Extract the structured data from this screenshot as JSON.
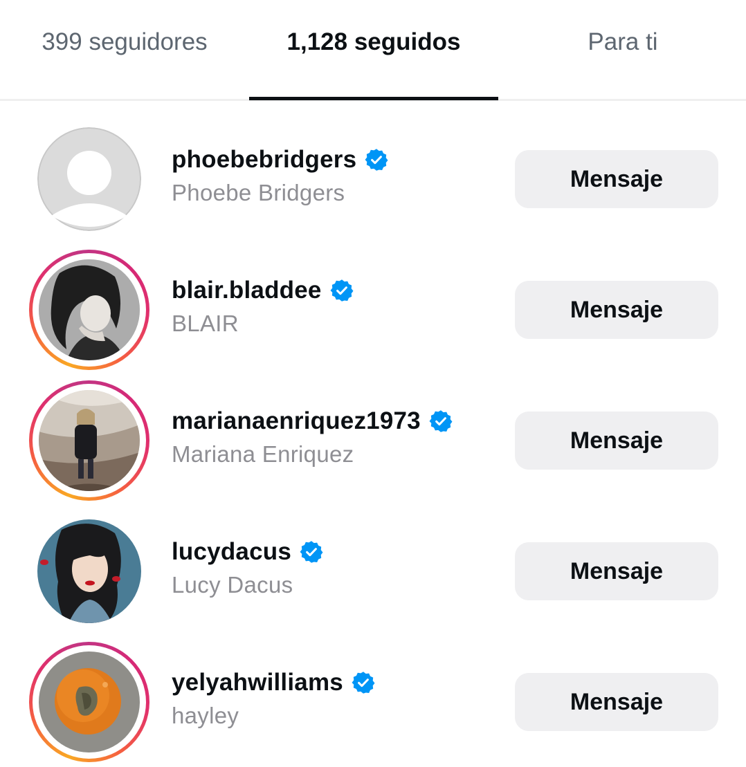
{
  "tabs": {
    "followers": "399 seguidores",
    "following": "1,128 seguidos",
    "for_you": "Para ti"
  },
  "colors": {
    "verified_badge": "#0095f6",
    "active_tab": "#0c1014",
    "button_bg": "#efeff1"
  },
  "icons": {
    "verified": "verified-badge-icon",
    "default_avatar": "default-avatar-icon"
  },
  "accounts": [
    {
      "username": "phoebebridgers",
      "full_name": "Phoebe Bridgers",
      "verified": true,
      "has_story": false,
      "button": "Mensaje"
    },
    {
      "username": "blair.bladdee",
      "full_name": "BLAIR",
      "verified": true,
      "has_story": true,
      "button": "Mensaje"
    },
    {
      "username": "marianaenriquez1973",
      "full_name": "Mariana Enriquez",
      "verified": true,
      "has_story": true,
      "button": "Mensaje"
    },
    {
      "username": "lucydacus",
      "full_name": "Lucy Dacus",
      "verified": true,
      "has_story": false,
      "button": "Mensaje"
    },
    {
      "username": "yelyahwilliams",
      "full_name": "hayley",
      "verified": true,
      "has_story": true,
      "button": "Mensaje"
    }
  ]
}
